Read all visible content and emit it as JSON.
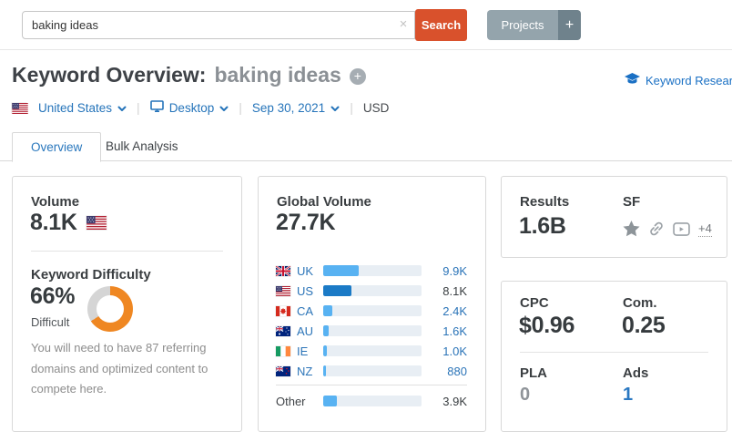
{
  "header": {
    "search_input_value": "baking ideas",
    "clear_icon": "×",
    "search_button": "Search",
    "projects_button": "Projects",
    "projects_add_button": "+"
  },
  "page": {
    "title": "Keyword Overview:",
    "title_keyword": "baking ideas",
    "keyword_research_link": "Keyword Research"
  },
  "filters": {
    "country": "United States",
    "device": "Desktop",
    "date": "Sep 30, 2021",
    "currency": "USD",
    "separator": "|"
  },
  "tabs": {
    "active": "Overview",
    "inactive": "Bulk Analysis"
  },
  "volume_card": {
    "label": "Volume",
    "value": "8.1K"
  },
  "keyword_difficulty": {
    "label": "Keyword Difficulty",
    "percent": "66%",
    "percent_number": 66,
    "level": "Difficult",
    "description": "You will need to have 87 referring domains and optimized content to compete here.",
    "donut_color": "#ef8722",
    "donut_track_color": "#d5d5d5"
  },
  "global_volume": {
    "label": "Global Volume",
    "value": "27.7K",
    "rows": [
      {
        "code": "UK",
        "value": "9.9K",
        "bar_percent": 36
      },
      {
        "code": "US",
        "value": "8.1K",
        "bar_percent": 29
      },
      {
        "code": "CA",
        "value": "2.4K",
        "bar_percent": 9
      },
      {
        "code": "AU",
        "value": "1.6K",
        "bar_percent": 6
      },
      {
        "code": "IE",
        "value": "1.0K",
        "bar_percent": 4
      },
      {
        "code": "NZ",
        "value": "880",
        "bar_percent": 3
      }
    ],
    "other_row": {
      "code": "Other",
      "value": "3.9K",
      "bar_percent": 14
    }
  },
  "results_card": {
    "label": "Results",
    "value": "1.6B",
    "serp_label": "SF",
    "more_features": "+4"
  },
  "cpc_card": {
    "cpc_label": "CPC",
    "cpc_value": "$0.96",
    "com_label": "Com.",
    "com_value": "0.25",
    "pla_label": "PLA",
    "pla_value": "0",
    "ads_label": "Ads",
    "ads_value": "1"
  }
}
